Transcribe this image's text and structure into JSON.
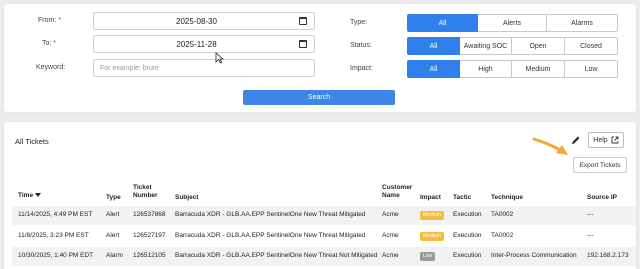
{
  "filters": {
    "from_label": "From:",
    "from_required": "*",
    "from_value": "2025-08-30",
    "to_label": "To:",
    "to_required": "*",
    "to_value": "2025-11-28",
    "keyword_label": "Keyword:",
    "keyword_placeholder": "For example: brute",
    "type_label": "Type:",
    "type_options": [
      "All",
      "Alerts",
      "Alarms"
    ],
    "type_selected": "All",
    "status_label": "Status:",
    "status_options": [
      "All",
      "Awaiting SOC",
      "Open",
      "Closed"
    ],
    "status_selected": "All",
    "impact_label": "Impact:",
    "impact_options": [
      "All",
      "High",
      "Medium",
      "Low"
    ],
    "impact_selected": "All",
    "search_label": "Search"
  },
  "tickets": {
    "title": "All Tickets",
    "help_label": "Help",
    "export_label": "Export Tickets",
    "columns": {
      "time": "Time",
      "type": "Type",
      "ticket_number": "Ticket Number",
      "subject": "Subject",
      "customer_name": "Customer Name",
      "impact": "Impact",
      "tactic": "Tactic",
      "technique": "Technique",
      "source_ip": "Source IP"
    },
    "rows": [
      {
        "time": "11/14/2025, 4:49 PM EST",
        "type": "Alert",
        "ticket_number": "126537868",
        "subject": "Barracuda XDR - GLB.AA.EPP SentinelOne New Threat Mitigated",
        "customer": "Acme",
        "impact": "Medium",
        "tactic": "Execution",
        "technique": "TA0002",
        "source_ip": "---"
      },
      {
        "time": "11/8/2025, 3:23 PM EST",
        "type": "Alert",
        "ticket_number": "126527197",
        "subject": "Barracuda XDR - GLB.AA.EPP SentinelOne New Threat Mitigated",
        "customer": "Acme",
        "impact": "Medium",
        "tactic": "Execution",
        "technique": "TA0002",
        "source_ip": "---"
      },
      {
        "time": "10/30/2025, 1:40 PM EDT",
        "type": "Alarm",
        "ticket_number": "126512105",
        "subject": "Barracuda XDR - GLB.AA.EPP SentinelOne New Threat Not Mitigated",
        "customer": "Acme",
        "impact": "Low",
        "tactic": "Execution",
        "technique": "Inter-Process Communication",
        "source_ip": "192.168.2.173"
      }
    ]
  },
  "colors": {
    "accent": "#2f80ed",
    "annotation_arrow": "#f0a830",
    "badge_medium": "#f2c037",
    "badge_low": "#9a9a9a"
  },
  "icons": [
    "calendar-icon",
    "cursor-icon",
    "pencil-icon",
    "external-link-icon",
    "sort-down-icon",
    "annotation-arrow-icon"
  ]
}
